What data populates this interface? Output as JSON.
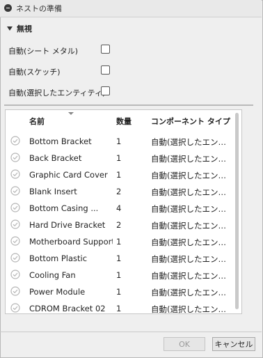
{
  "dialog": {
    "title": "ネストの準備"
  },
  "ignore_section": {
    "heading": "無視",
    "options": [
      {
        "label": "自動(シート メタル)",
        "checked": false
      },
      {
        "label": "自動(スケッチ)",
        "checked": false
      },
      {
        "label": "自動(選択したエンティティ)",
        "checked": false
      }
    ]
  },
  "table": {
    "headers": {
      "name": "名前",
      "qty": "数量",
      "type": "コンポーネント タイプ"
    },
    "rows": [
      {
        "name": "Bottom Bracket",
        "qty": "1",
        "type": "自動(選択したエンティティ)"
      },
      {
        "name": "Back Bracket",
        "qty": "1",
        "type": "自動(選択したエンティティ)"
      },
      {
        "name": "Graphic Card Cover",
        "qty": "1",
        "type": "自動(選択したエンティティ)"
      },
      {
        "name": "Blank Insert",
        "qty": "2",
        "type": "自動(選択したエンティティ)"
      },
      {
        "name": "Bottom Casing ...",
        "qty": "4",
        "type": "自動(選択したエンティティ)"
      },
      {
        "name": "Hard Drive Bracket",
        "qty": "2",
        "type": "自動(選択したエンティティ)"
      },
      {
        "name": "Motherboard Support",
        "qty": "1",
        "type": "自動(選択したエンティティ)"
      },
      {
        "name": "Bottom Plastic",
        "qty": "1",
        "type": "自動(選択したエンティティ)"
      },
      {
        "name": "Cooling Fan",
        "qty": "1",
        "type": "自動(選択したエンティティ)"
      },
      {
        "name": "Power Module",
        "qty": "1",
        "type": "自動(選択したエンティティ)"
      },
      {
        "name": "CDROM Bracket 02",
        "qty": "1",
        "type": "自動(選択したエンティティ)"
      }
    ]
  },
  "buttons": {
    "ok": "OK",
    "cancel": "キャンセル"
  }
}
